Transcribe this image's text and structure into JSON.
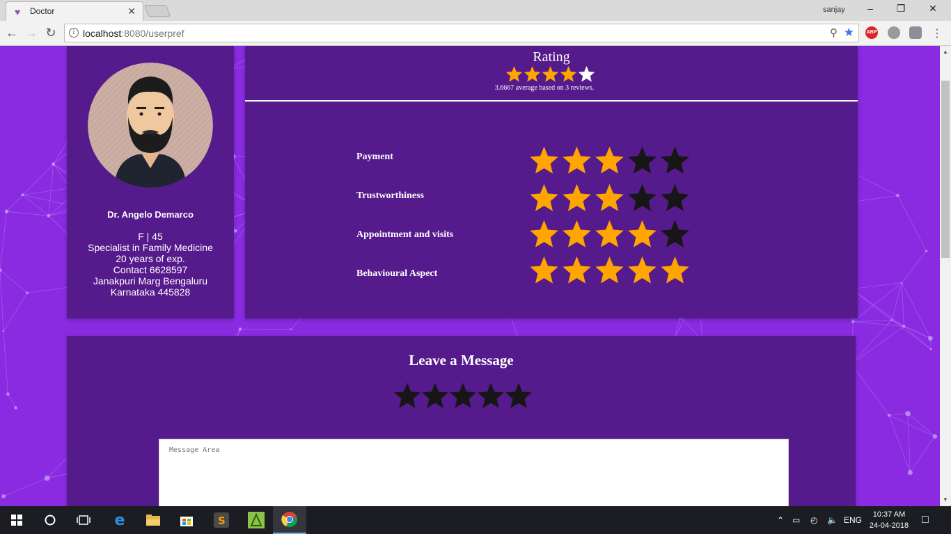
{
  "browser": {
    "tab_title": "Doctor",
    "url_host": "localhost",
    "url_rest": ":8080/userpref",
    "window_user": "sanjay",
    "extension_abp": "ABP"
  },
  "profile": {
    "name": "Dr. Angelo Demarco",
    "gender_age": "F | 45",
    "specialty": "Specialist in Family Medicine",
    "experience": "20 years of exp.",
    "contact": "Contact 6628597",
    "address_line1": "Janakpuri Marg Bengaluru",
    "address_line2": "Karnataka 445828"
  },
  "rating": {
    "title": "Rating",
    "filled_stars": 4,
    "total_stars": 5,
    "summary": "3.6667 average based on 3 reviews."
  },
  "aspects": [
    {
      "label": "Payment",
      "stars": 3
    },
    {
      "label": "Trustworthiness",
      "stars": 3
    },
    {
      "label": "Appointment and visits",
      "stars": 4
    },
    {
      "label": "Behavioural Aspect",
      "stars": 5
    }
  ],
  "message": {
    "title": "Leave a Message",
    "stars": 0,
    "placeholder": "Message Area"
  },
  "taskbar": {
    "language": "ENG",
    "time": "10:37 AM",
    "date": "24-04-2018"
  },
  "colors": {
    "page_bg": "#8a2be2",
    "panel_bg": "#551a8b",
    "star_on": "#ffa500",
    "star_off": "#161616",
    "star_white": "#ffffff"
  },
  "icons": [
    "favicon-heart-icon",
    "tab-close-icon",
    "back-icon",
    "forward-icon",
    "reload-icon",
    "info-icon",
    "zoom-icon",
    "bookmark-star-icon",
    "menu-dots-icon",
    "windows-start-icon",
    "cortana-icon",
    "task-view-icon",
    "edge-icon",
    "file-explorer-icon",
    "store-icon",
    "sublime-icon",
    "app-icon",
    "chrome-icon",
    "network-icon",
    "volume-icon",
    "notification-icon"
  ]
}
